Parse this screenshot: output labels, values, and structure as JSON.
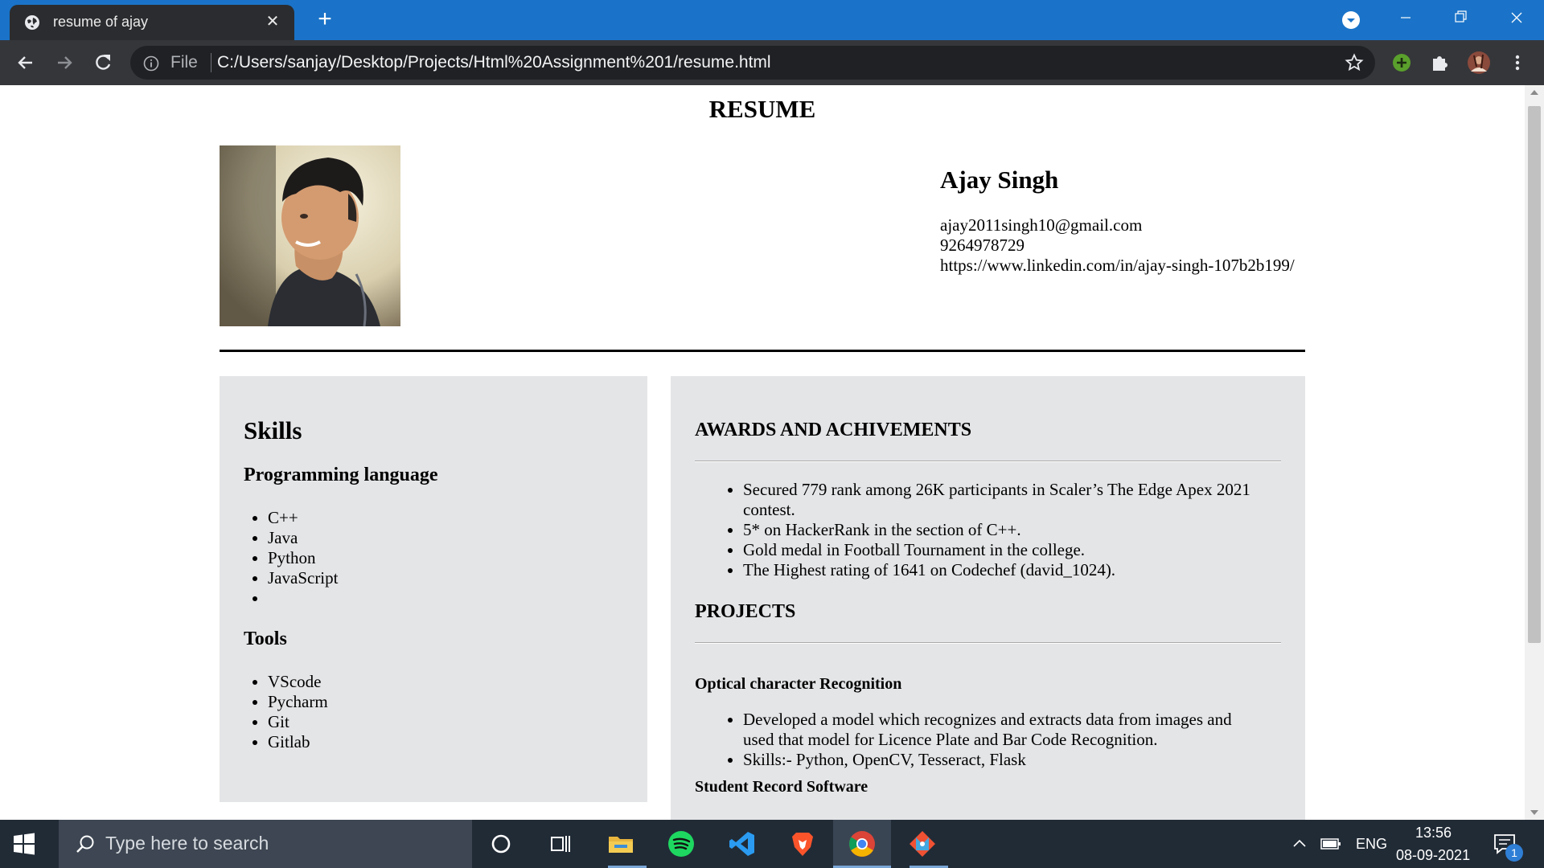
{
  "browser": {
    "tab_title": "resume of ajay",
    "address_scheme": "File",
    "url": "C:/Users/sanjay/Desktop/Projects/Html%20Assignment%201/resume.html"
  },
  "resume": {
    "heading": "RESUME",
    "name": "Ajay Singh",
    "email": "ajay2011singh10@gmail.com",
    "phone": "9264978729",
    "linkedin": "https://www.linkedin.com/in/ajay-singh-107b2b199/"
  },
  "skills": {
    "title": "Skills",
    "programming_heading": "Programming language",
    "programming": [
      "C++",
      "Java",
      "Python",
      "JavaScript",
      ""
    ],
    "tools_heading": "Tools",
    "tools": [
      "VScode",
      "Pycharm",
      "Git",
      "Gitlab"
    ]
  },
  "awards": {
    "title": "AWARDS AND ACHIVEMENTS",
    "items": [
      "Secured 779 rank among 26K participants in Scaler’s The Edge Apex 2021 contest.",
      "5* on HackerRank in the section of C++.",
      "Gold medal in Football Tournament in the college.",
      "The Highest rating of 1641 on Codechef (david_1024)."
    ]
  },
  "projects": {
    "title": "PROJECTS",
    "list": [
      {
        "name": "Optical character Recognition",
        "points": [
          "Developed a model which recognizes and extracts data from images and used that model for Licence Plate and Bar Code Recognition.",
          "Skills:- Python, OpenCV, Tesseract, Flask"
        ]
      },
      {
        "name": "Student Record Software",
        "points": []
      }
    ]
  },
  "taskbar": {
    "search_placeholder": "Type here to search",
    "language": "ENG",
    "time": "13:56",
    "date": "08-09-2021",
    "notification_count": "1"
  },
  "colors": {
    "chrome_blue": "#1a73c8",
    "toolbar": "#35363a",
    "section_bg": "#e4e5e7",
    "taskbar": "#212b36"
  }
}
